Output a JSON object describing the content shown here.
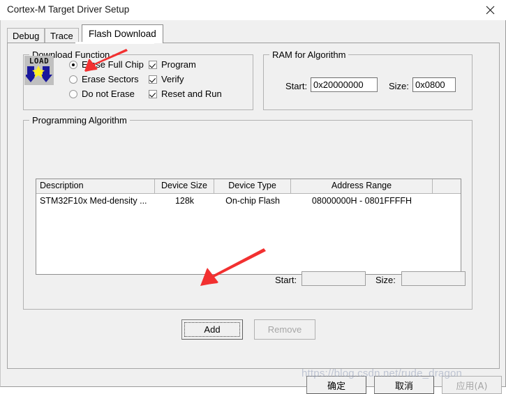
{
  "window": {
    "title": "Cortex-M Target Driver Setup",
    "close_icon": "close-icon"
  },
  "tabs": [
    {
      "id": "debug",
      "label": "Debug",
      "active": false
    },
    {
      "id": "trace",
      "label": "Trace",
      "active": false
    },
    {
      "id": "flash",
      "label": "Flash Download",
      "active": true
    }
  ],
  "download_function": {
    "group_title": "Download Function",
    "icon_text": "LOAD",
    "radios": [
      {
        "label": "Erase Full Chip",
        "checked": true
      },
      {
        "label": "Erase Sectors",
        "checked": false
      },
      {
        "label": "Do not Erase",
        "checked": false
      }
    ],
    "checkboxes": [
      {
        "label": "Program",
        "checked": true
      },
      {
        "label": "Verify",
        "checked": true
      },
      {
        "label": "Reset and Run",
        "checked": true
      }
    ]
  },
  "ram_for_algorithm": {
    "group_title": "RAM for Algorithm",
    "start_label": "Start:",
    "start_value": "0x20000000",
    "size_label": "Size:",
    "size_value": "0x0800"
  },
  "programming_algorithm": {
    "group_title": "Programming Algorithm",
    "columns": [
      "Description",
      "Device Size",
      "Device Type",
      "Address Range",
      ""
    ],
    "rows": [
      {
        "description": "STM32F10x Med-density ...",
        "device_size": "128k",
        "device_type": "On-chip Flash",
        "address_range": "08000000H - 0801FFFFH",
        "extra": ""
      }
    ],
    "selection_start_label": "Start:",
    "selection_start_value": "",
    "selection_size_label": "Size:",
    "selection_size_value": "",
    "add_label": "Add",
    "remove_label": "Remove",
    "remove_enabled": false
  },
  "dialog_buttons": {
    "ok": "确定",
    "cancel": "取消",
    "apply": "应用(A)",
    "apply_enabled": false
  },
  "annotations": {
    "arrow_color": "#f23030",
    "arrow_1_target": "Erase Full Chip",
    "arrow_2_target": "Add"
  },
  "watermark": {
    "text": "https://blog.csdn.net/rude_dragon"
  }
}
